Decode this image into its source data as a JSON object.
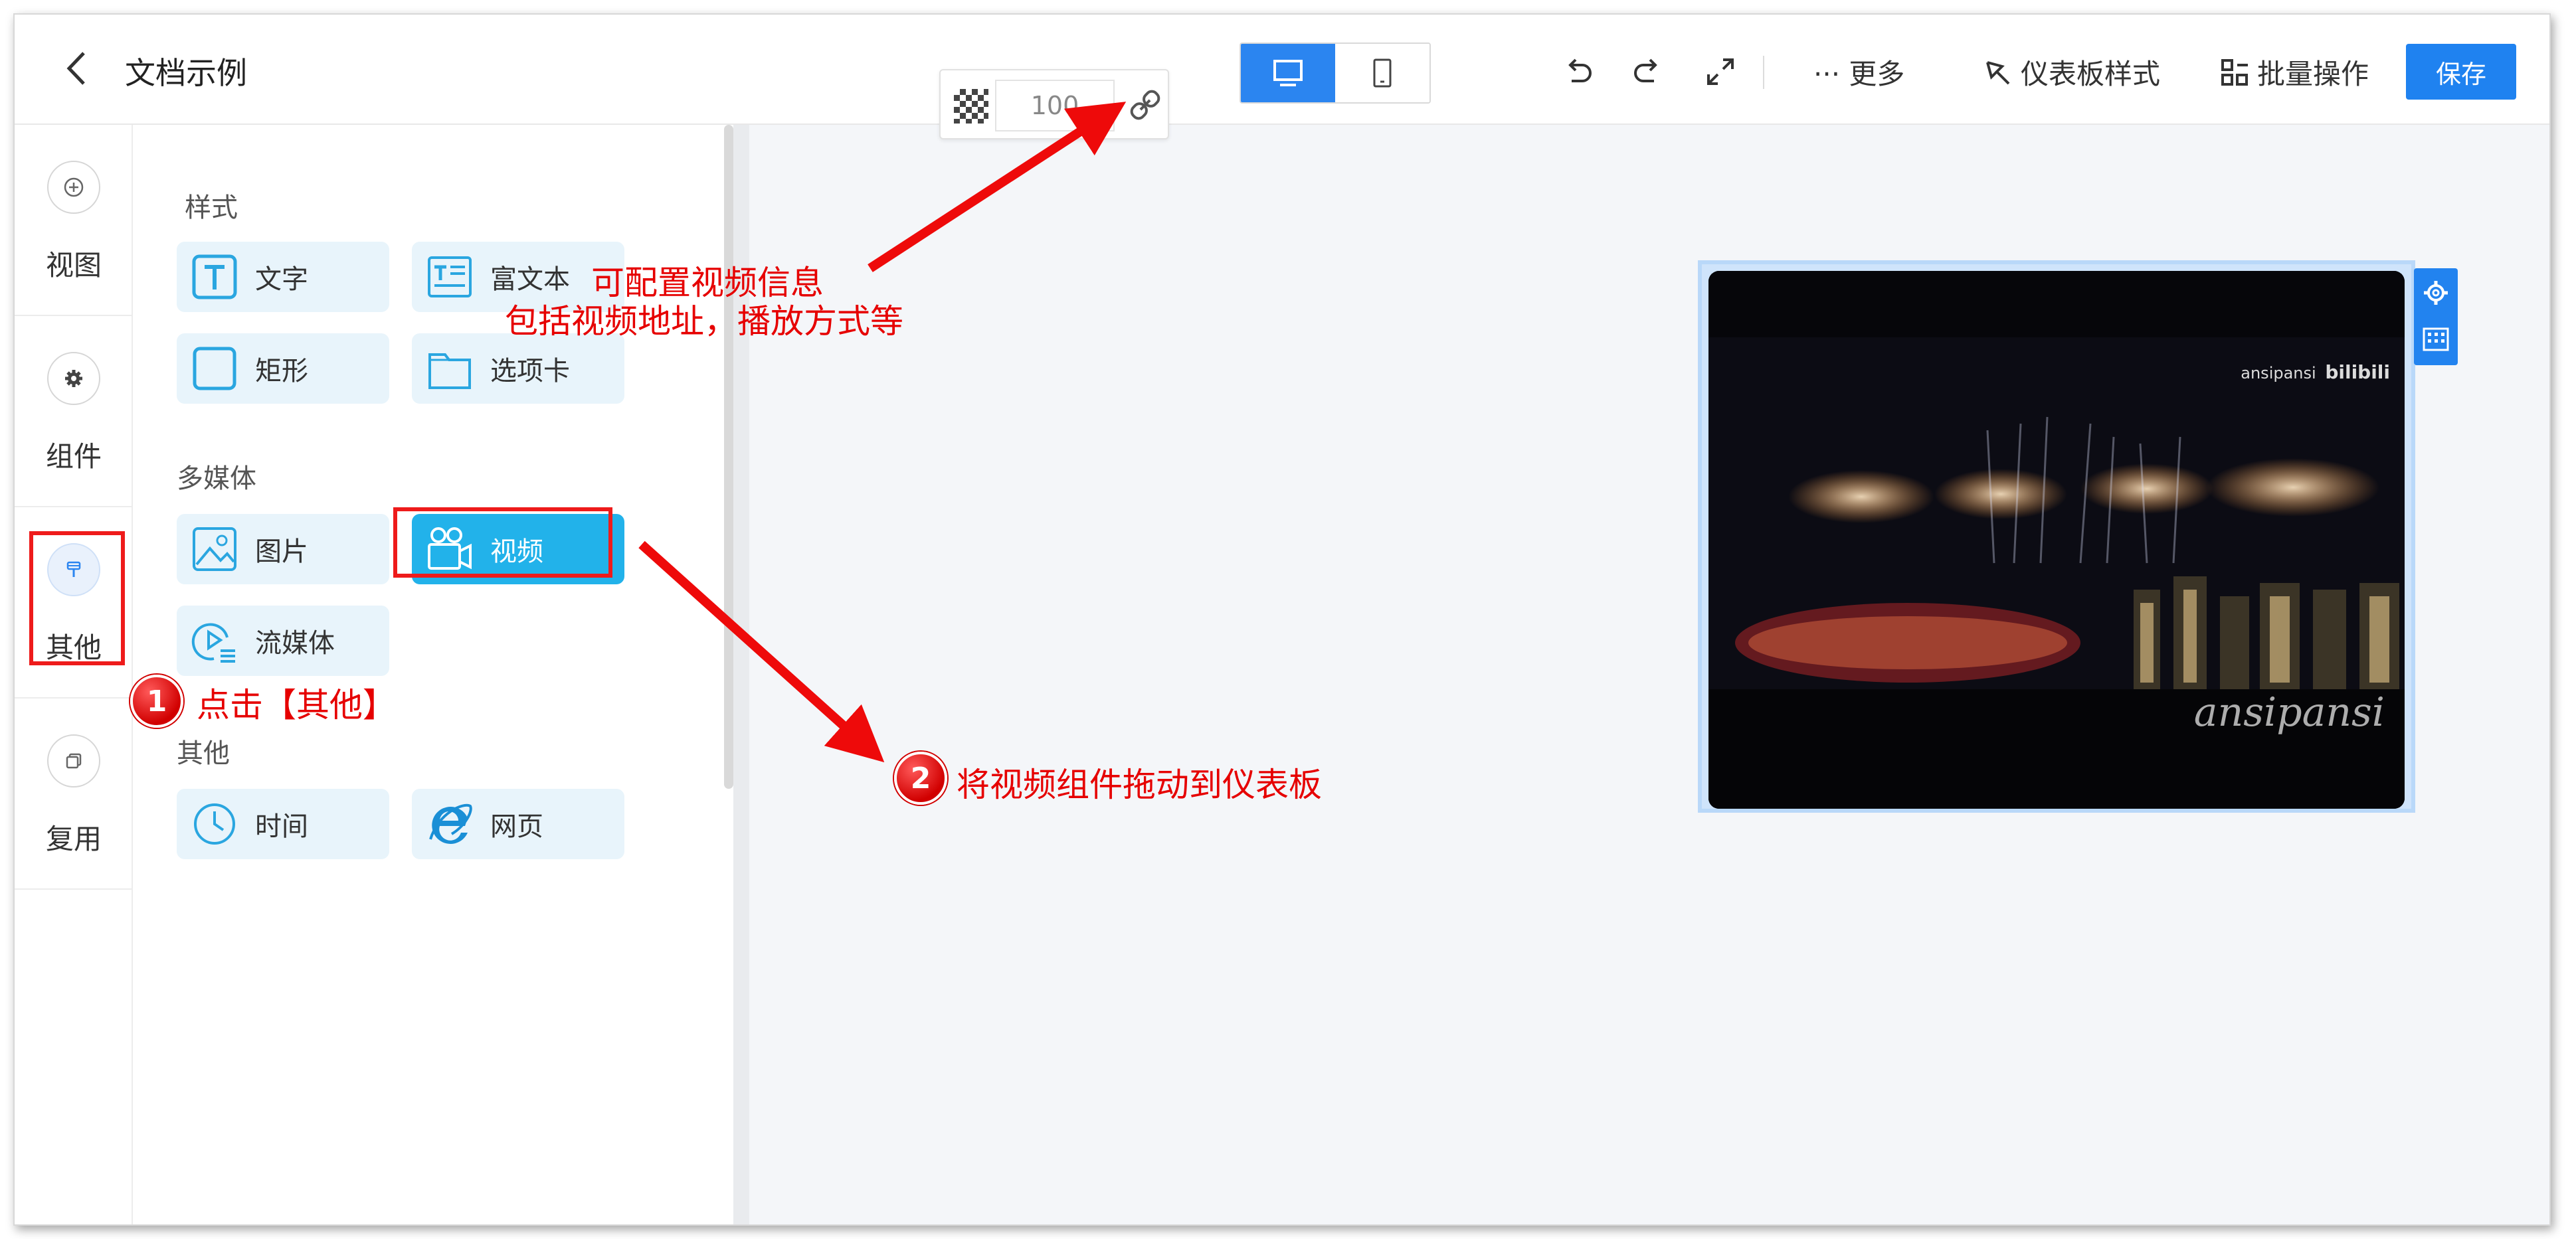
{
  "header": {
    "title": "文档示例",
    "toolbar": {
      "more_label": "··· 更多",
      "dashboard_style_label": "仪表板样式",
      "batch_label": "批量操作",
      "save_label": "保存"
    }
  },
  "rail": {
    "items": [
      {
        "label": "视图",
        "icon": "plus-circle-icon"
      },
      {
        "label": "组件",
        "icon": "gear-icon"
      },
      {
        "label": "其他",
        "icon": "brush-icon",
        "active": true
      },
      {
        "label": "复用",
        "icon": "copy-icon"
      }
    ]
  },
  "panel": {
    "sections": [
      {
        "title": "样式",
        "items": [
          {
            "label": "文字",
            "icon": "text-t-icon"
          },
          {
            "label": "富文本",
            "icon": "rich-text-icon"
          },
          {
            "label": "矩形",
            "icon": "rectangle-icon"
          },
          {
            "label": "选项卡",
            "icon": "tab-card-icon"
          }
        ]
      },
      {
        "title": "多媒体",
        "items": [
          {
            "label": "图片",
            "icon": "image-icon"
          },
          {
            "label": "视频",
            "icon": "video-camera-icon",
            "selected": true
          },
          {
            "label": "流媒体",
            "icon": "stream-icon"
          }
        ]
      },
      {
        "title": "其他",
        "items": [
          {
            "label": "时间",
            "icon": "clock-icon"
          },
          {
            "label": "网页",
            "icon": "ie-browser-icon"
          }
        ]
      }
    ]
  },
  "canvas": {
    "opacity_value": "100",
    "video": {
      "watermark_top": "ansipansi",
      "watermark_brand": "bilibili",
      "watermark_bottom": "ansipansi"
    }
  },
  "annotations": {
    "step1_number": "1",
    "step1_text": "点击【其他】",
    "step2_number": "2",
    "step2_text": "将视频组件拖动到仪表板",
    "config_line1": "可配置视频信息",
    "config_line2": "包括视频地址，播放方式等"
  },
  "colors": {
    "accent": "#1f82f0",
    "card_bg": "#e8f4fb",
    "card_selected": "#22b2ea",
    "annotation_red": "#e60000"
  }
}
